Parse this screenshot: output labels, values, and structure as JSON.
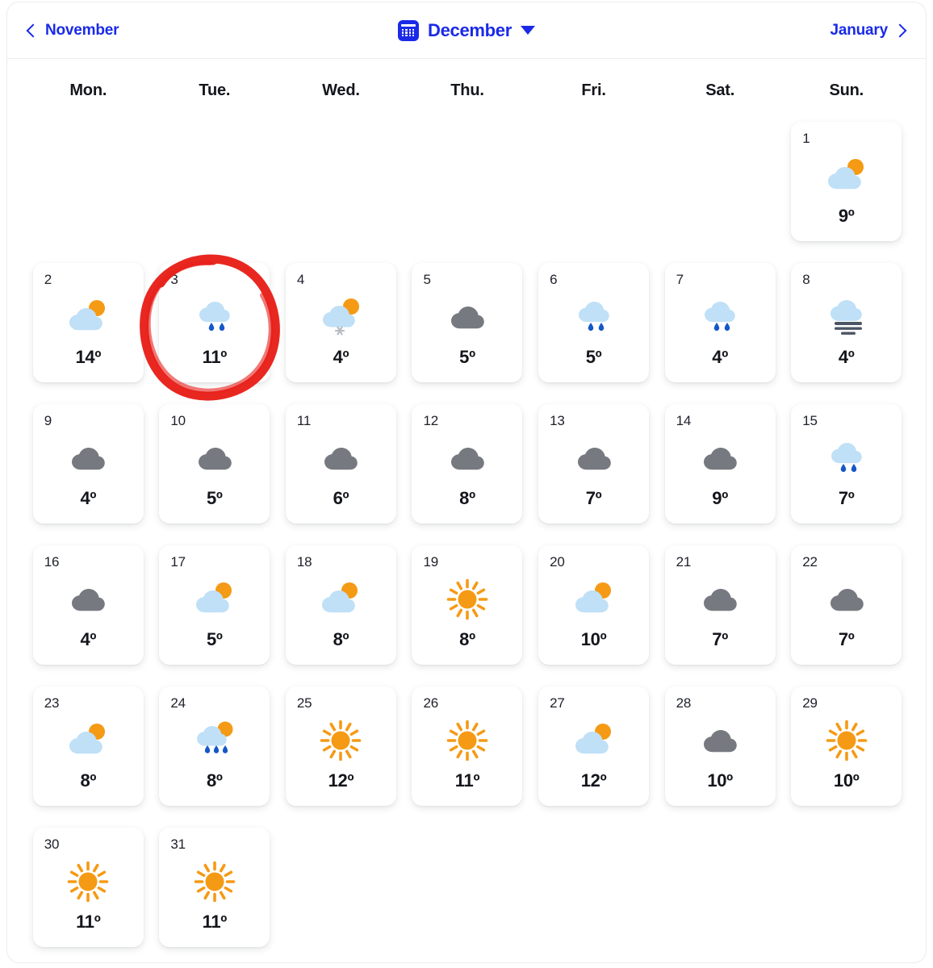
{
  "header": {
    "prev_month": "November",
    "current_month": "December",
    "next_month": "January",
    "calendar_icon": "calendar-icon",
    "dropdown_icon": "chevron-down-icon",
    "prev_icon": "chevron-left-icon",
    "next_icon": "chevron-right-icon",
    "accent_color": "#1a2ae8"
  },
  "weekdays": [
    "Mon.",
    "Tue.",
    "Wed.",
    "Thu.",
    "Fri.",
    "Sat.",
    "Sun."
  ],
  "colors": {
    "cloud_light": "#bfe0f7",
    "cloud_gray": "#767a80",
    "sun_orange": "#f59a15",
    "rain_blue": "#1557c8",
    "snow_gray": "#b8bcc4",
    "fog_gray": "#4c5566",
    "annotation_red": "#e8201a",
    "text_dark": "#14161c"
  },
  "annotation": {
    "type": "hand-drawn-circle",
    "target_day": "3",
    "color": "#e8201a"
  },
  "leading_blanks": 6,
  "days": [
    {
      "day": "1",
      "icon": "partly-cloudy-icon",
      "temp": "9º"
    },
    {
      "day": "2",
      "icon": "partly-cloudy-icon",
      "temp": "14º"
    },
    {
      "day": "3",
      "icon": "rain-icon",
      "temp": "11º"
    },
    {
      "day": "4",
      "icon": "snow-sun-icon",
      "temp": "4º"
    },
    {
      "day": "5",
      "icon": "cloudy-icon",
      "temp": "5º"
    },
    {
      "day": "6",
      "icon": "rain-icon",
      "temp": "5º"
    },
    {
      "day": "7",
      "icon": "rain-icon",
      "temp": "4º"
    },
    {
      "day": "8",
      "icon": "fog-icon",
      "temp": "4º"
    },
    {
      "day": "9",
      "icon": "cloudy-icon",
      "temp": "4º"
    },
    {
      "day": "10",
      "icon": "cloudy-icon",
      "temp": "5º"
    },
    {
      "day": "11",
      "icon": "cloudy-icon",
      "temp": "6º"
    },
    {
      "day": "12",
      "icon": "cloudy-icon",
      "temp": "8º"
    },
    {
      "day": "13",
      "icon": "cloudy-icon",
      "temp": "7º"
    },
    {
      "day": "14",
      "icon": "cloudy-icon",
      "temp": "9º"
    },
    {
      "day": "15",
      "icon": "rain-icon",
      "temp": "7º"
    },
    {
      "day": "16",
      "icon": "cloudy-icon",
      "temp": "4º"
    },
    {
      "day": "17",
      "icon": "partly-cloudy-icon",
      "temp": "5º"
    },
    {
      "day": "18",
      "icon": "partly-cloudy-icon",
      "temp": "8º"
    },
    {
      "day": "19",
      "icon": "sunny-icon",
      "temp": "8º"
    },
    {
      "day": "20",
      "icon": "partly-cloudy-icon",
      "temp": "10º"
    },
    {
      "day": "21",
      "icon": "cloudy-icon",
      "temp": "7º"
    },
    {
      "day": "22",
      "icon": "cloudy-icon",
      "temp": "7º"
    },
    {
      "day": "23",
      "icon": "partly-cloudy-icon",
      "temp": "8º"
    },
    {
      "day": "24",
      "icon": "rain-sun-icon",
      "temp": "8º"
    },
    {
      "day": "25",
      "icon": "sunny-icon",
      "temp": "12º"
    },
    {
      "day": "26",
      "icon": "sunny-icon",
      "temp": "11º"
    },
    {
      "day": "27",
      "icon": "partly-cloudy-icon",
      "temp": "12º"
    },
    {
      "day": "28",
      "icon": "cloudy-icon",
      "temp": "10º"
    },
    {
      "day": "29",
      "icon": "sunny-icon",
      "temp": "10º"
    },
    {
      "day": "30",
      "icon": "sunny-icon",
      "temp": "11º"
    },
    {
      "day": "31",
      "icon": "sunny-icon",
      "temp": "11º"
    }
  ]
}
